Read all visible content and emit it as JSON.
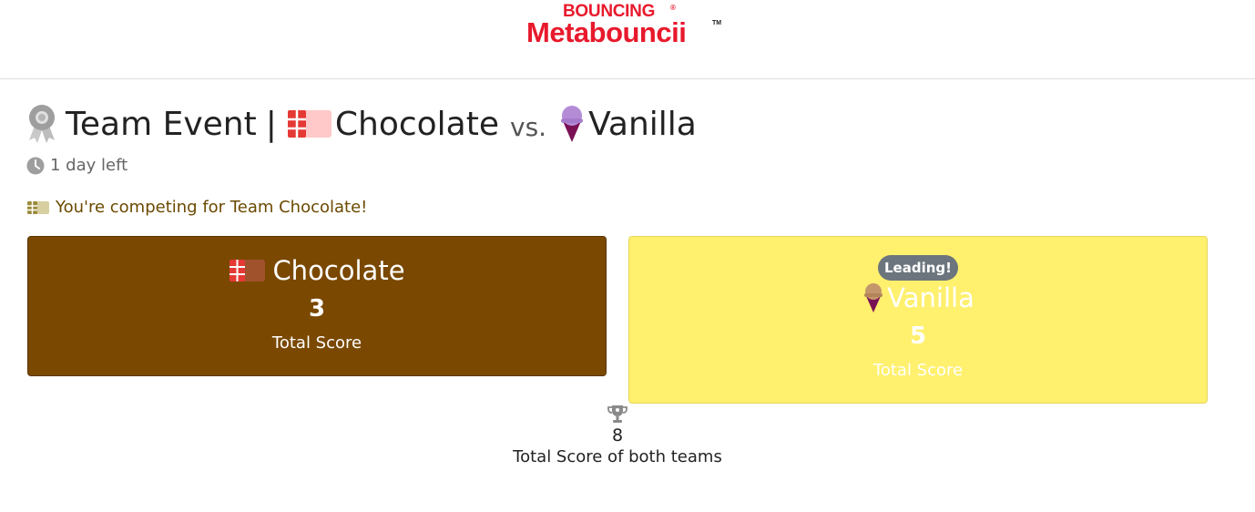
{
  "header": {
    "brand_top": "BOUNCING",
    "brand_main": "Metabouncii",
    "brand_reg": "®",
    "brand_tm": "TM"
  },
  "event": {
    "title": "Team Event",
    "separator": "|",
    "team_a": "Chocolate",
    "vs": "vs.",
    "team_b": "Vanilla",
    "time_left": "1 day left",
    "competing_message": "You're competing for Team Chocolate!"
  },
  "cards": {
    "chocolate": {
      "name": "Chocolate",
      "score": "3",
      "label": "Total Score",
      "color": "#7a4800"
    },
    "vanilla": {
      "badge": "Leading!",
      "name": "Vanilla",
      "score": "5",
      "label": "Total Score",
      "color": "#fff06e"
    }
  },
  "totals": {
    "value": "8",
    "label": "Total Score of both teams"
  },
  "icons": {
    "ribbon": "award-ribbon-icon",
    "chocolate": "chocolate-bar-icon",
    "vanilla": "ice-cream-icon",
    "clock": "clock-icon",
    "trophy": "trophy-icon"
  },
  "colors": {
    "brand": "#e8192c",
    "chocolate_card": "#7a4800",
    "vanilla_card": "#fff06e",
    "badge": "#6c757d"
  }
}
